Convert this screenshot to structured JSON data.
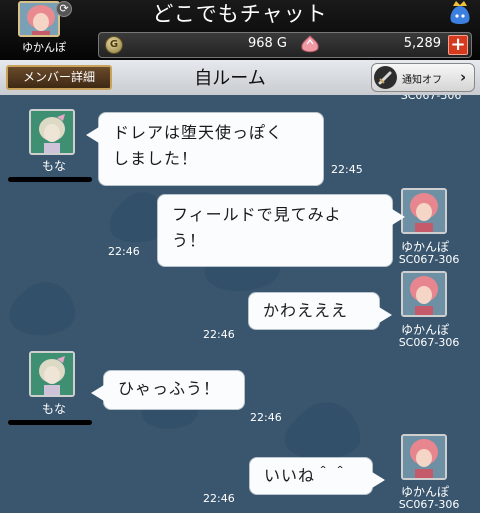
{
  "header": {
    "self_name": "ゆかんぽ",
    "title": "どこでもチャット",
    "gold_icon_glyph": "G",
    "gold_value": "968 G",
    "gem_value": "5,289",
    "plus_glyph": "+"
  },
  "room_bar": {
    "member_button_label": "メンバー詳細",
    "room_name": "自ルーム",
    "notify_label": "通知オフ",
    "chevron_glyph": "›"
  },
  "chat": {
    "top_partial_id": "SC067-306",
    "messages": [
      {
        "side": "left",
        "sender": "もな",
        "text_lines": [
          "ドレアは堕天使っぽく",
          "しました！"
        ],
        "time": "22:45"
      },
      {
        "side": "right",
        "sender": "ゆかんぽ",
        "sender_id": "SC067-306",
        "text_lines": [
          "フィールドで見てみよ",
          "う！"
        ],
        "time": "22:46"
      },
      {
        "side": "right",
        "sender": "ゆかんぽ",
        "sender_id": "SC067-306",
        "text_lines": [
          "かわえええ"
        ],
        "time": "22:46"
      },
      {
        "side": "left",
        "sender": "もな",
        "text_lines": [
          "ひゃっふう！"
        ],
        "time": "22:46"
      },
      {
        "side": "right",
        "sender": "ゆかんぽ",
        "sender_id": "SC067-306",
        "text_lines": [
          "いいね＾＾"
        ],
        "time": "22:46"
      }
    ]
  },
  "colors": {
    "chat_bg": "#39566e",
    "bubble_bg": "#fbfcfd",
    "accent_gold": "#c9a35c",
    "plus_red": "#d63a1e"
  }
}
